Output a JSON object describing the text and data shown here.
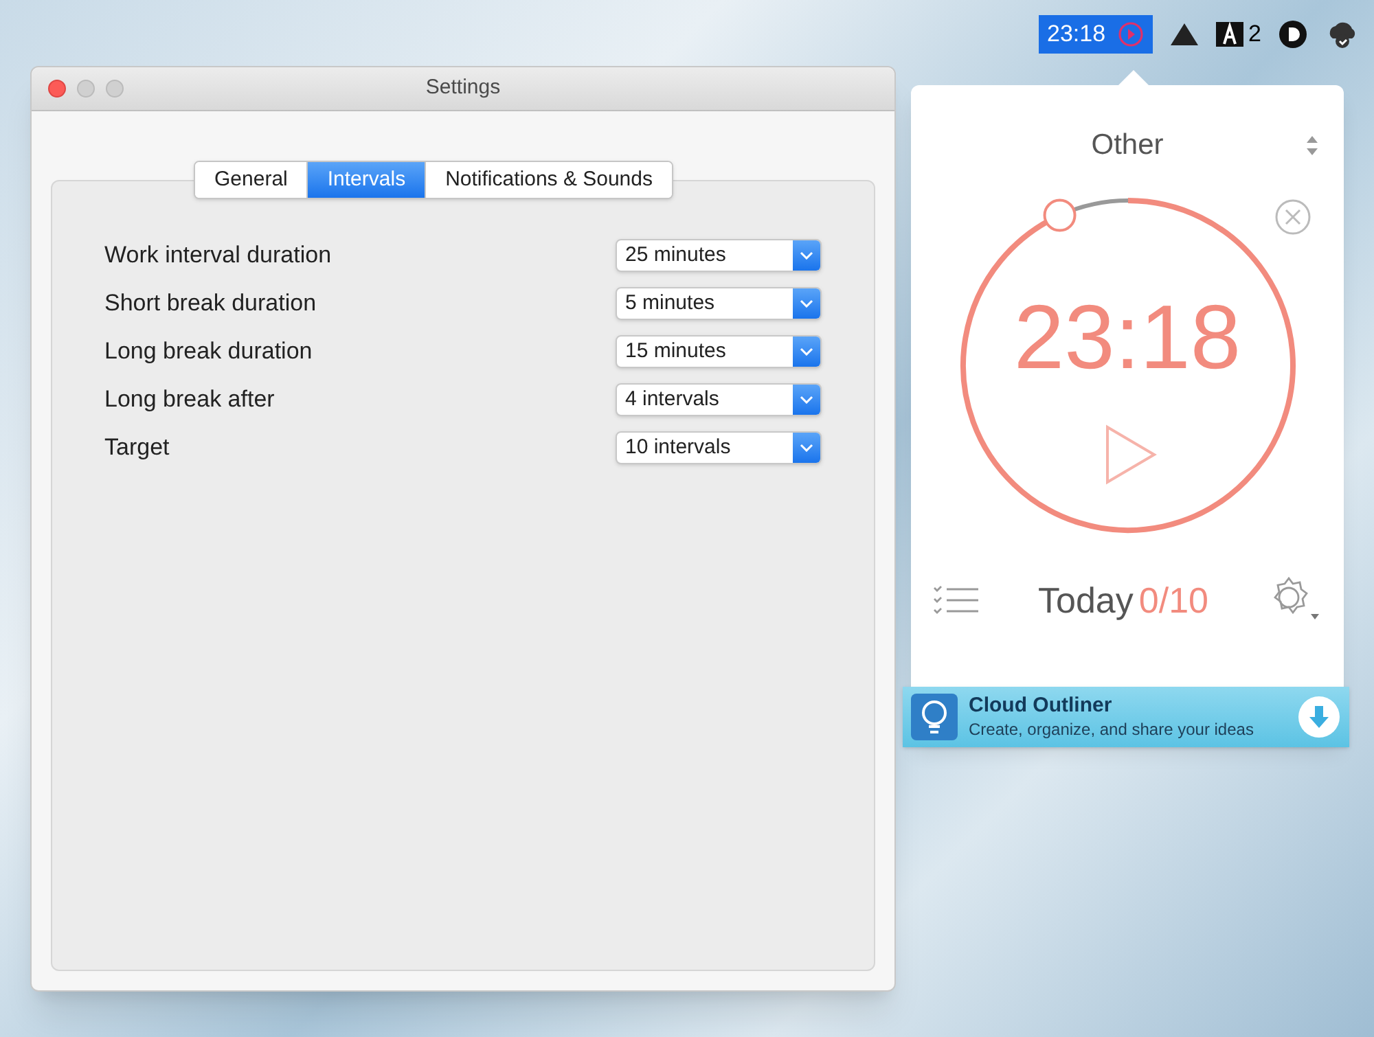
{
  "menu_bar": {
    "items": [
      {
        "kind": "timer",
        "label": "23:18",
        "selected": true
      },
      {
        "kind": "triangle"
      },
      {
        "kind": "adobe",
        "label": "2"
      },
      {
        "kind": "circle"
      },
      {
        "kind": "cloud"
      }
    ]
  },
  "window": {
    "title": "Settings"
  },
  "tabs": [
    {
      "label": "General",
      "selected": false
    },
    {
      "label": "Intervals",
      "selected": true
    },
    {
      "label": "Notifications & Sounds",
      "selected": false
    }
  ],
  "settings": [
    {
      "label": "Work interval duration",
      "value": "25 minutes"
    },
    {
      "label": "Short break duration",
      "value": "5 minutes"
    },
    {
      "label": "Long break duration",
      "value": "15 minutes"
    },
    {
      "label": "Long break after",
      "value": "4 intervals"
    },
    {
      "label": "Target",
      "value": "10 intervals"
    }
  ],
  "timer": {
    "category": "Other",
    "time": "23:18",
    "today_label": "Today",
    "today_count": "0/10"
  },
  "ad": {
    "title": "Cloud Outliner",
    "subtitle": "Create, organize, and share your ideas"
  }
}
